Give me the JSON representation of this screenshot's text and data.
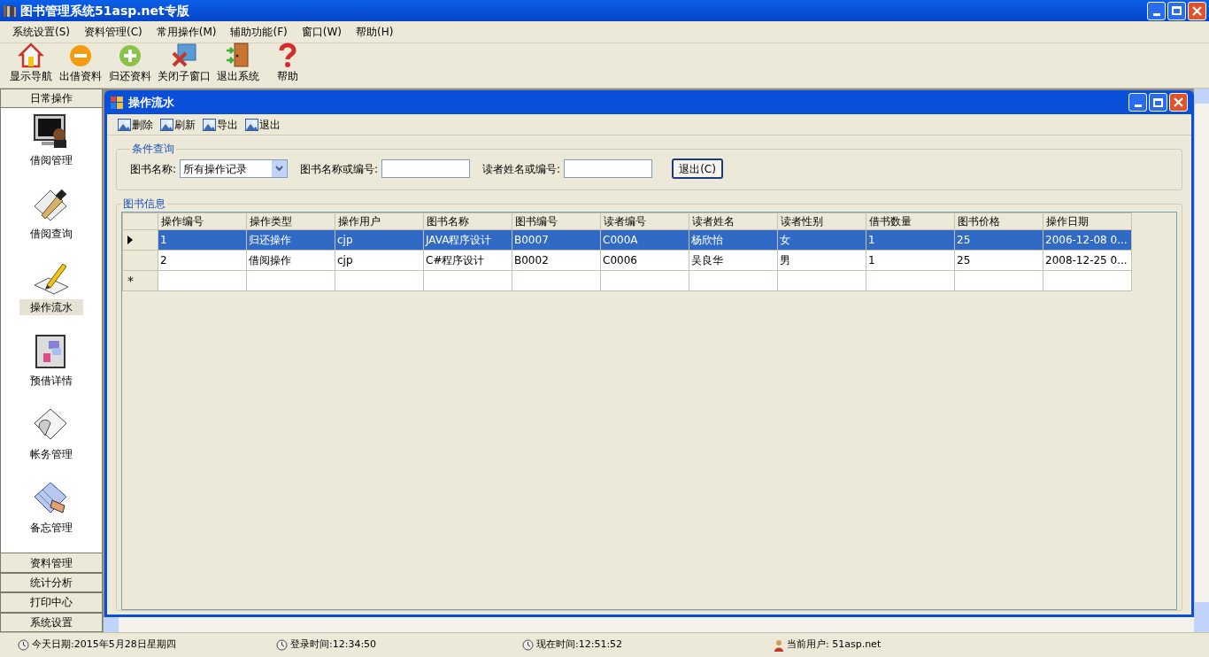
{
  "window": {
    "title": "图书管理系统51asp.net专版"
  },
  "menu": [
    "系统设置(S)",
    "资料管理(C)",
    "常用操作(M)",
    "辅助功能(F)",
    "窗口(W)",
    "帮助(H)"
  ],
  "toolbar": [
    {
      "label": "显示导航",
      "kind": "home"
    },
    {
      "label": "出借资料",
      "kind": "minus"
    },
    {
      "label": "归还资料",
      "kind": "plus"
    },
    {
      "label": "关闭子窗口",
      "kind": "close"
    },
    {
      "label": "退出系统",
      "kind": "exit"
    },
    {
      "label": "帮助",
      "kind": "help"
    }
  ],
  "sidebar": {
    "sections_top": [
      {
        "label": "日常操作"
      }
    ],
    "items": [
      {
        "label": "借阅管理",
        "kind": "monitor",
        "selected": false
      },
      {
        "label": "借阅查询",
        "kind": "pen",
        "selected": false
      },
      {
        "label": "操作流水",
        "kind": "pencil",
        "selected": true
      },
      {
        "label": "预借详情",
        "kind": "notebook",
        "selected": false
      },
      {
        "label": "帐务管理",
        "kind": "scroll",
        "selected": false
      },
      {
        "label": "备忘管理",
        "kind": "grid",
        "selected": false
      }
    ],
    "sections_bottom": [
      {
        "label": "资料管理"
      },
      {
        "label": "统计分析"
      },
      {
        "label": "打印中心"
      },
      {
        "label": "系统设置"
      }
    ]
  },
  "child": {
    "title": "操作流水",
    "toolbar": [
      "删除",
      "刷新",
      "导出",
      "退出"
    ],
    "query": {
      "title": "条件查询",
      "book_label": "图书名称:",
      "book_select": "所有操作记录",
      "name_label": "图书名称或编号:",
      "reader_label": "读者姓名或编号:",
      "button": "退出(C)"
    },
    "grid": {
      "title": "图书信息",
      "columns": [
        "操作编号",
        "操作类型",
        "操作用户",
        "图书名称",
        "图书编号",
        "读者编号",
        "读者姓名",
        "读者性别",
        "借书数量",
        "图书价格",
        "操作日期"
      ],
      "rows": [
        {
          "selected": true,
          "cells": [
            "1",
            "归还操作",
            "cjp",
            "JAVA程序设计",
            "B0007",
            "C000A",
            "杨欣怡",
            "女",
            "1",
            "25",
            "2006-12-08 0..."
          ]
        },
        {
          "selected": false,
          "cells": [
            "2",
            "借阅操作",
            "cjp",
            "C#程序设计",
            "B0002",
            "C0006",
            "吴良华",
            "男",
            "1",
            "25",
            "2008-12-25 0..."
          ]
        }
      ],
      "new_row_marker": "*"
    }
  },
  "status_bar": [
    {
      "label": "今天日期:2015年5月28日星期四",
      "kind": "clock"
    },
    {
      "label": "登录时间:12:34:50",
      "kind": "clock"
    },
    {
      "label": "现在时间:12:51:52",
      "kind": "clock"
    },
    {
      "label": "当前用户: 51asp.net",
      "kind": "user"
    }
  ]
}
